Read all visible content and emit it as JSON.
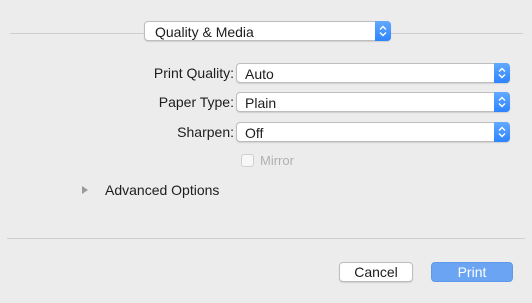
{
  "preset": {
    "selected": "Quality & Media"
  },
  "options": {
    "print_quality": {
      "label": "Print Quality:",
      "value": "Auto"
    },
    "paper_type": {
      "label": "Paper Type:",
      "value": "Plain"
    },
    "sharpen": {
      "label": "Sharpen:",
      "value": "Off"
    },
    "mirror": {
      "label": "Mirror",
      "checked": false,
      "enabled": false
    }
  },
  "advanced": {
    "label": "Advanced Options",
    "expanded": false
  },
  "footer": {
    "cancel_label": "Cancel",
    "print_label": "Print"
  },
  "colors": {
    "accent": "#2e83ff",
    "print_button": "#6aa4f3",
    "background": "#ececec"
  },
  "icons": {
    "popup_stepper": "chevron-up-down-icon",
    "disclosure": "disclosure-triangle-icon"
  }
}
